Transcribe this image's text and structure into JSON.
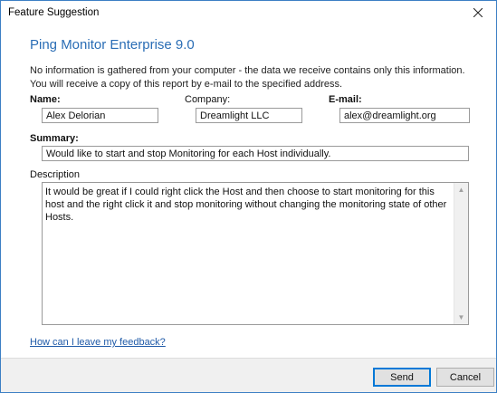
{
  "window": {
    "title": "Feature Suggestion"
  },
  "heading": "Ping Monitor Enterprise 9.0",
  "info": "No information is gathered from your computer - the data we receive contains only this information. You will receive a copy of this report by e-mail to the specified address.",
  "form": {
    "name_label": "Name:",
    "name_value": "Alex Delorian",
    "company_label": "Company:",
    "company_value": "Dreamlight LLC",
    "email_label": "E-mail:",
    "email_value": "alex@dreamlight.org",
    "summary_label": "Summary:",
    "summary_value": "Would like to start and stop Monitoring for each Host individually.",
    "description_label": "Description",
    "description_value": "It would be great if I could right click the Host and then choose to start monitoring for this host and the right click it and stop monitoring without changing the monitoring state of other Hosts."
  },
  "feedback_link": "How can I leave my feedback?",
  "buttons": {
    "send": "Send",
    "cancel": "Cancel"
  },
  "colors": {
    "accent": "#2a6db5",
    "link": "#1f5aa8",
    "window_border": "#3c7fc4"
  },
  "icons": {
    "close": "close-icon",
    "scroll_up": "chevron-up-icon",
    "scroll_down": "chevron-down-icon"
  }
}
